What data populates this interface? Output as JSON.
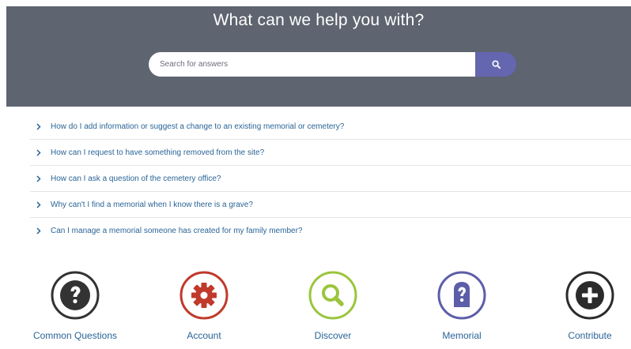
{
  "hero": {
    "title": "What can we help you with?",
    "background": "#5e6470"
  },
  "search": {
    "placeholder": "Search for answers",
    "value": "",
    "button_icon": "search-icon",
    "button_color": "#6466b0"
  },
  "faq": {
    "items": [
      {
        "label": "How do I add information or suggest a change to an existing memorial or cemetery?"
      },
      {
        "label": "How can I request to have something removed from the site?"
      },
      {
        "label": "How can I ask a question of the cemetery office?"
      },
      {
        "label": "Why can't I find a memorial when I know there is a grave?"
      },
      {
        "label": "Can I manage a memorial someone has created for my family member?"
      }
    ],
    "link_color": "#2a6496"
  },
  "categories": [
    {
      "label": "Common Questions",
      "icon": "question-icon",
      "color": "#333333"
    },
    {
      "label": "Account",
      "icon": "gear-icon",
      "color": "#c0392b"
    },
    {
      "label": "Discover",
      "icon": "magnifier-icon",
      "color": "#9bc53d"
    },
    {
      "label": "Memorial",
      "icon": "memorial-question-icon",
      "color": "#5c5ea8"
    },
    {
      "label": "Contribute",
      "icon": "plus-icon",
      "color": "#2b2b2b"
    }
  ]
}
